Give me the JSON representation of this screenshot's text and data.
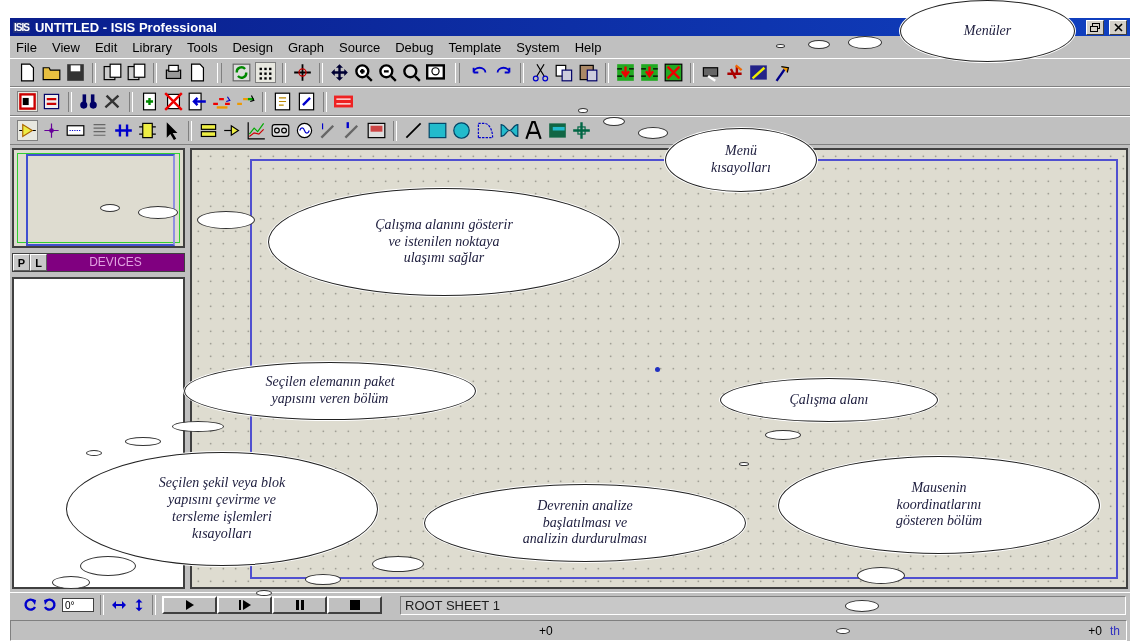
{
  "window": {
    "title": "UNTITLED - ISIS Professional",
    "app_badge": "ISIS"
  },
  "menus": [
    "File",
    "View",
    "Edit",
    "Library",
    "Tools",
    "Design",
    "Graph",
    "Source",
    "Debug",
    "Template",
    "System",
    "Help"
  ],
  "sidebar": {
    "tabs": [
      "P",
      "L"
    ],
    "header": "DEVICES"
  },
  "bottom_bar": {
    "angle": "0°",
    "sheet": "ROOT SHEET 1"
  },
  "status_bar": {
    "x": "+0",
    "y": "+0",
    "units": "th"
  },
  "callouts": [
    {
      "text": "Menüler"
    },
    {
      "text": "Menü\nkısayolları"
    },
    {
      "text": "Çalışma alanını gösterir\nve istenilen noktaya\nulaşımı sağlar"
    },
    {
      "text": "Seçilen elemanın paket\nyapısını veren bölüm"
    },
    {
      "text": "Çalışma alanı"
    },
    {
      "text": "Seçilen şekil veya blok\nyapısını çevirme ve\ntersleme işlemleri\nkısayolları"
    },
    {
      "text": "Devrenin analize\nbaşlatılması ve\nanalizin durdurulması"
    },
    {
      "text": "Mausenin\nkoordinatlarını\ngösteren bölüm"
    }
  ]
}
